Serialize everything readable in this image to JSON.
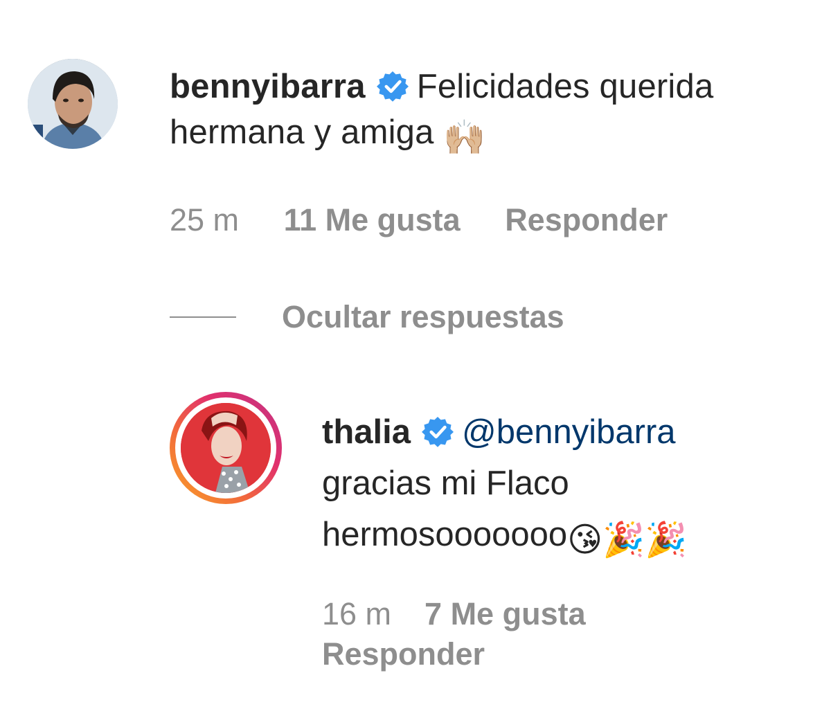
{
  "comment": {
    "username": "bennyibarra",
    "text": "Felicidades querida hermana y amiga",
    "emoji": "🙌🏼",
    "time": "25 m",
    "likes": "11 Me gusta",
    "reply_label": "Responder"
  },
  "hide_replies_label": "Ocultar respuestas",
  "reply": {
    "username": "thalia",
    "mention": "@bennyibarra",
    "text": "gracias mi Flaco hermosooooooo",
    "emoji": "😘🎉🎉",
    "time": "16 m",
    "likes": "7 Me gusta",
    "reply_label": "Responder"
  },
  "colors": {
    "verified_blue": "#3897f0",
    "meta_gray": "#8e8e8e",
    "mention_blue": "#00376b",
    "story_ring": [
      "#f9a328",
      "#e1306c",
      "#c13584"
    ]
  }
}
